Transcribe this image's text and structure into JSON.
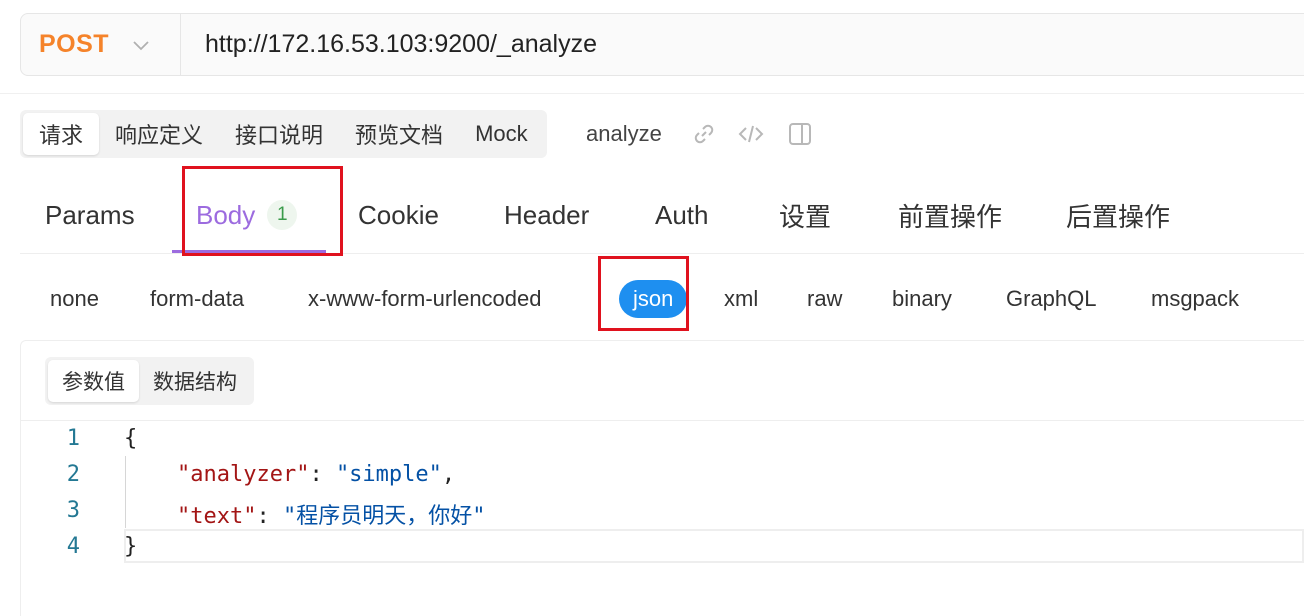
{
  "request": {
    "method": "POST",
    "url": "http://172.16.53.103:9200/_analyze"
  },
  "top_tabs": [
    {
      "label": "请求",
      "active": true
    },
    {
      "label": "响应定义"
    },
    {
      "label": "接口说明"
    },
    {
      "label": "预览文档"
    },
    {
      "label": "Mock"
    }
  ],
  "api_name": "analyze",
  "main_tabs": [
    {
      "label": "Params"
    },
    {
      "label": "Body",
      "badge": "1",
      "active": true
    },
    {
      "label": "Cookie"
    },
    {
      "label": "Header"
    },
    {
      "label": "Auth"
    },
    {
      "label": "设置"
    },
    {
      "label": "前置操作"
    },
    {
      "label": "后置操作"
    }
  ],
  "body_types": [
    "none",
    "form-data",
    "x-www-form-urlencoded",
    "json",
    "xml",
    "raw",
    "binary",
    "GraphQL",
    "msgpack"
  ],
  "body_selected": "json",
  "editor_tabs": [
    {
      "label": "参数值",
      "active": true
    },
    {
      "label": "数据结构"
    }
  ],
  "code_lines": [
    {
      "n": "1",
      "open": "{"
    },
    {
      "n": "2",
      "key": "\"analyzer\"",
      "colon": ": ",
      "value": "\"simple\"",
      "tail": ","
    },
    {
      "n": "3",
      "key": "\"text\"",
      "colon": ": ",
      "value": "\"程序员明天，你好\"",
      "tail": ""
    },
    {
      "n": "4",
      "close": "}"
    }
  ],
  "colors": {
    "method": "#f5832a",
    "active_tab": "#9c6bdf",
    "json_pill": "#1e8ff0",
    "highlight_box": "#e0121e"
  },
  "icons": [
    "link-icon",
    "code-icon",
    "sidebar-panel-icon",
    "chevron-down-icon"
  ]
}
